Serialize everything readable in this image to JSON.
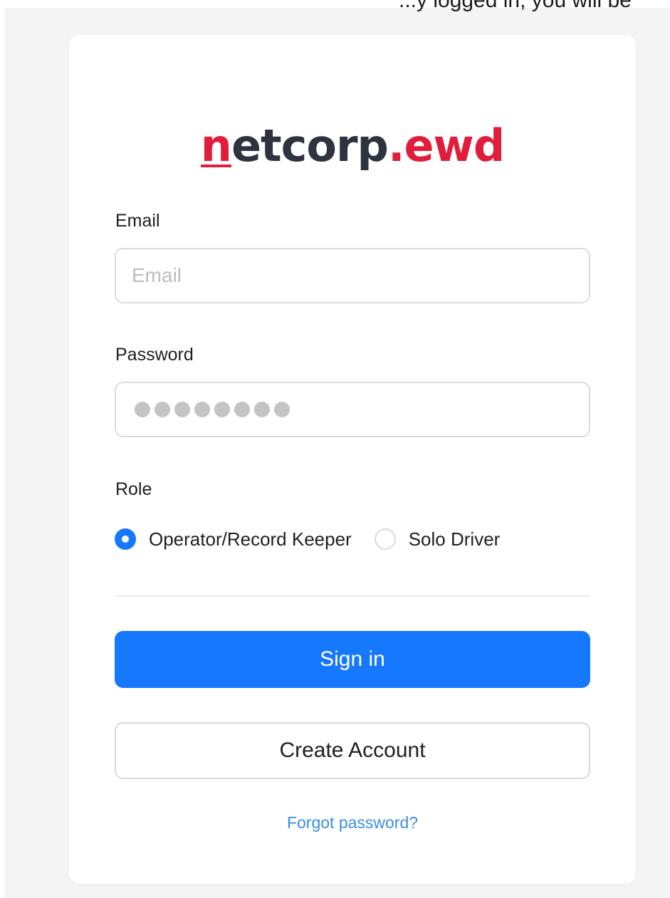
{
  "page": {
    "top_clip_text": "...y logged in, you will be"
  },
  "logo": {
    "n": "n",
    "main": "etcorp",
    "ext": ".ewd"
  },
  "form": {
    "email": {
      "label": "Email",
      "placeholder": "Email",
      "value": ""
    },
    "password": {
      "label": "Password",
      "masked_dot_count": 8
    },
    "role": {
      "label": "Role",
      "options": [
        {
          "label": "Operator/Record Keeper",
          "checked": true
        },
        {
          "label": "Solo Driver",
          "checked": false
        }
      ]
    }
  },
  "actions": {
    "sign_in": "Sign in",
    "create_account": "Create Account",
    "forgot_password": "Forgot password?"
  },
  "colors": {
    "primary": "#1677ff",
    "brand_red": "#e01e3c",
    "brand_dark": "#2d3440",
    "link": "#3a8ee6"
  }
}
